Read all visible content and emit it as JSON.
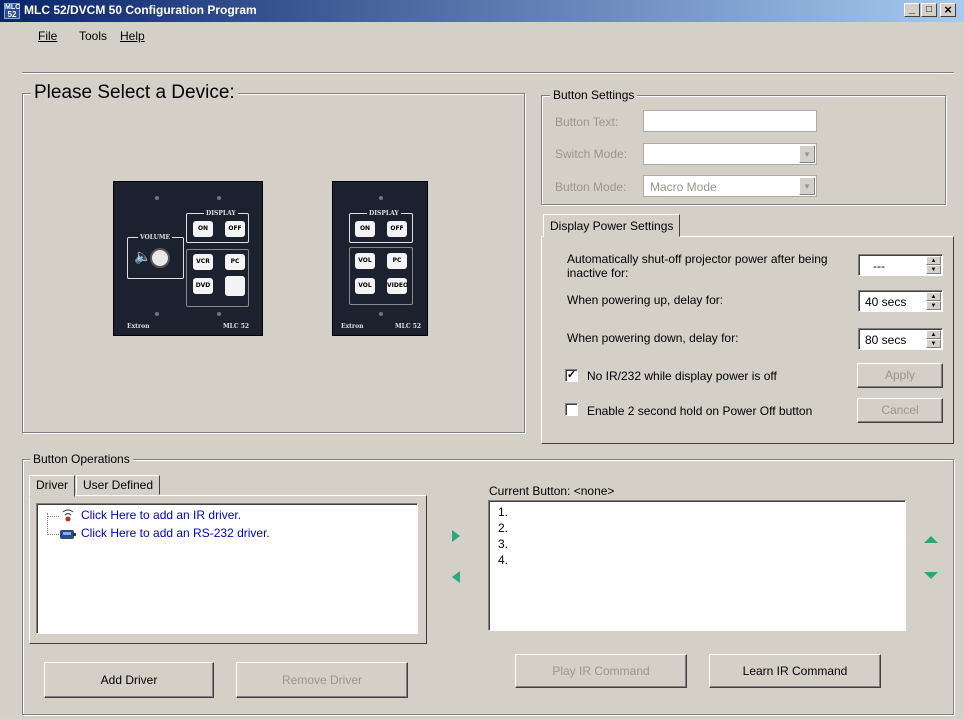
{
  "window": {
    "icon_text_top": "MLC",
    "icon_text_bottom": "52",
    "title": "MLC 52/DVCM 50 Configuration Program",
    "minimize": "_",
    "maximize": "□",
    "close": "×"
  },
  "menu": {
    "file": "File",
    "tools": "Tools",
    "help": "Help"
  },
  "device_select": {
    "title": "Please Select a Device:",
    "mlc52": {
      "display_label": "DISPLAY",
      "volume_label": "VOLUME",
      "keys": [
        "ON",
        "OFF",
        "VCR",
        "PC",
        "DVD",
        ""
      ],
      "brand": "Extron",
      "model": "MLC 52"
    },
    "dvcm50": {
      "display_label": "DISPLAY",
      "keys": [
        "ON",
        "OFF",
        "VOL",
        "PC",
        "VOL",
        "VIDEO"
      ],
      "brand": "Extron",
      "model": "MLC 52"
    }
  },
  "button_settings": {
    "title": "Button Settings",
    "button_text_label": "Button Text:",
    "button_text_value": "",
    "switch_mode_label": "Switch Mode:",
    "switch_mode_value": "",
    "button_mode_label": "Button Mode:",
    "button_mode_value": "Macro Mode"
  },
  "display_power": {
    "tab": "Display Power Settings",
    "auto_shutoff_label": "Automatically shut-off projector power after being inactive for:",
    "auto_shutoff_value": "---",
    "power_up_label": "When powering up, delay for:",
    "power_up_value": "40 secs",
    "power_down_label": "When powering down, delay for:",
    "power_down_value": "80 secs",
    "no_ir_label": "No IR/232 while display power is off",
    "no_ir_checked": true,
    "hold_label": "Enable 2 second hold on Power Off button",
    "hold_checked": false,
    "apply": "Apply",
    "cancel": "Cancel"
  },
  "button_operations": {
    "title": "Button Operations",
    "tabs": [
      "Driver",
      "User Defined"
    ],
    "drivers": [
      {
        "label": "Click Here to add an IR driver.",
        "icon": "ir-remote-icon"
      },
      {
        "label": "Click Here to add an RS-232 driver.",
        "icon": "rs232-icon"
      }
    ],
    "current_button_label": "Current Button: <none>",
    "steps": [
      "1.",
      "2.",
      "3.",
      "4."
    ],
    "add_driver": "Add Driver",
    "remove_driver": "Remove Driver",
    "play_ir": "Play IR Command",
    "learn_ir": "Learn IR Command"
  },
  "colors": {
    "accent_green": "#2aa87a",
    "link_blue": "#0000cc",
    "title_blue": "#0a246a"
  }
}
